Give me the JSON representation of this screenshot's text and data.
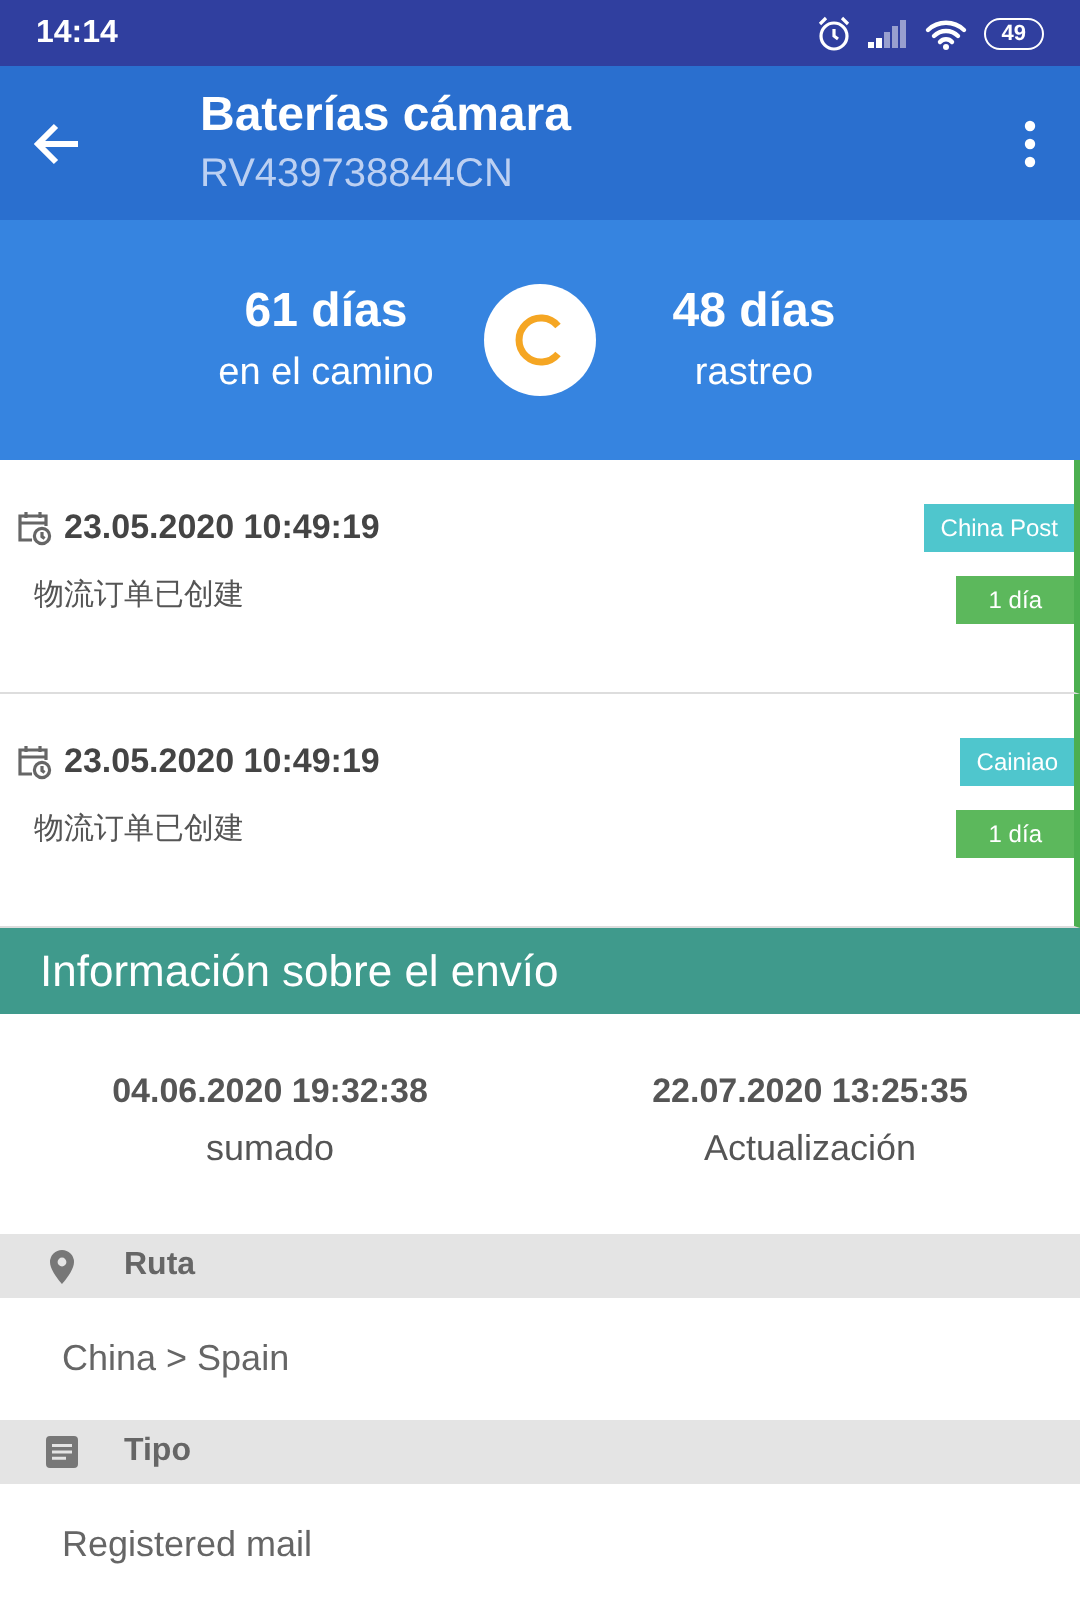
{
  "status_bar": {
    "time": "14:14",
    "battery": "49"
  },
  "app_bar": {
    "title": "Baterías cámara",
    "subtitle": "RV439738844CN"
  },
  "summary": [
    {
      "value": "61 días",
      "label": "en el camino"
    },
    {
      "value": "48 días",
      "label": "rastreo"
    }
  ],
  "events": [
    {
      "datetime": "23.05.2020 10:49:19",
      "description": "物流订单已创建",
      "carrier": "China Post",
      "duration": "1 día"
    },
    {
      "datetime": "23.05.2020 10:49:19",
      "description": "物流订单已创建",
      "carrier": "Cainiao",
      "duration": "1 día"
    }
  ],
  "info": {
    "title": "Información sobre el envío",
    "dates": [
      {
        "value": "04.06.2020 19:32:38",
        "label": "sumado"
      },
      {
        "value": "22.07.2020 13:25:35",
        "label": "Actualización"
      }
    ],
    "sections": [
      {
        "kind": "location",
        "label": "Ruta",
        "value": "China > Spain"
      },
      {
        "kind": "document",
        "label": "Tipo",
        "value": "Registered mail"
      }
    ]
  }
}
